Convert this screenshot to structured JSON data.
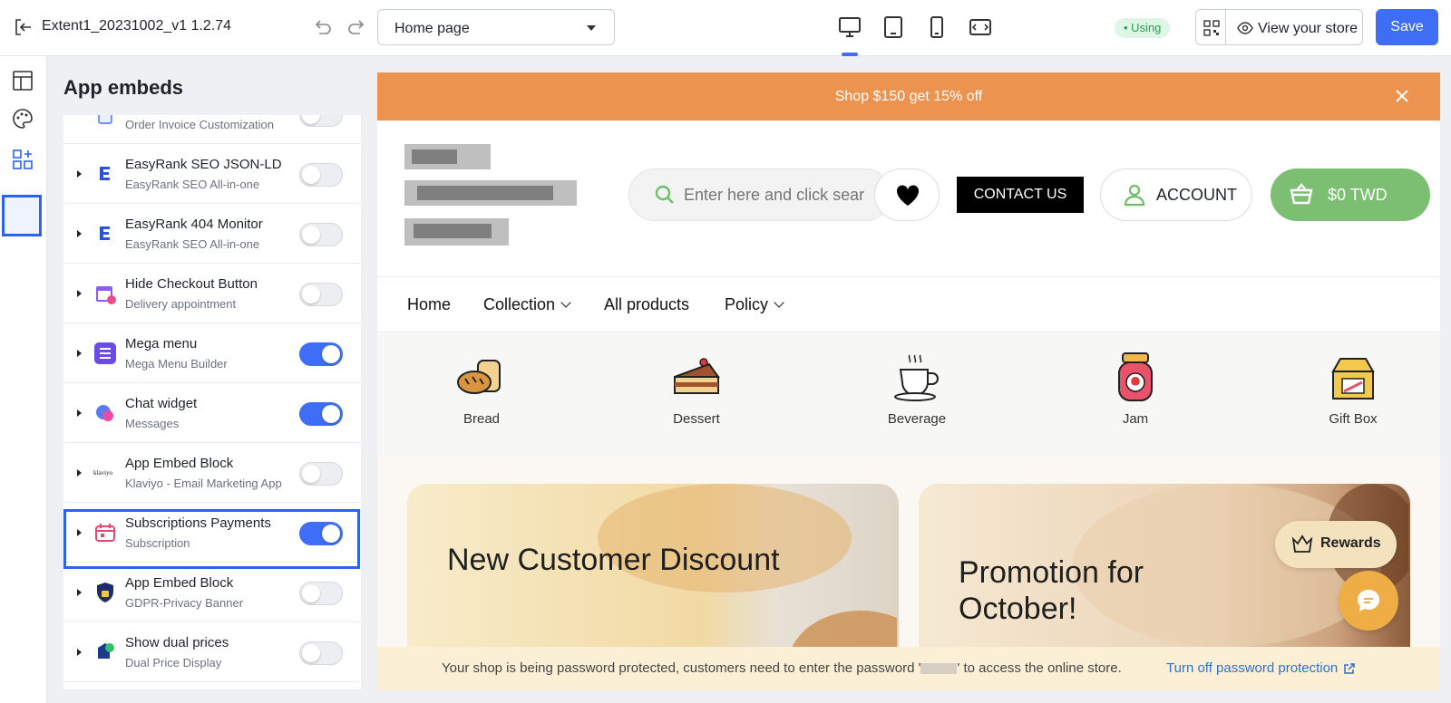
{
  "topbar": {
    "title": "Extent1_20231002_v1 1.2.74",
    "page_select": "Home page",
    "status_badge": "• Using",
    "view_store": "View your store",
    "save": "Save"
  },
  "panel": {
    "title": "App embeds",
    "items": [
      {
        "name": "",
        "sub": "Order Invoice Customization",
        "enabled": false
      },
      {
        "name": "EasyRank SEO JSON-LD",
        "sub": "EasyRank SEO All-in-one",
        "enabled": false
      },
      {
        "name": "EasyRank 404 Monitor",
        "sub": "EasyRank SEO All-in-one",
        "enabled": false
      },
      {
        "name": "Hide Checkout Button",
        "sub": "Delivery appointment",
        "enabled": false
      },
      {
        "name": "Mega menu",
        "sub": "Mega Menu Builder",
        "enabled": true
      },
      {
        "name": "Chat widget",
        "sub": "Messages",
        "enabled": true
      },
      {
        "name": "App Embed Block",
        "sub": "Klaviyo - Email Marketing App",
        "enabled": false,
        "icon_text": "klaviyo"
      },
      {
        "name": "Subscriptions Payments",
        "sub": "Subscription",
        "enabled": true
      },
      {
        "name": "App Embed Block",
        "sub": "GDPR-Privacy Banner",
        "enabled": false
      },
      {
        "name": "Show dual prices",
        "sub": "Dual Price Display",
        "enabled": false
      }
    ]
  },
  "preview": {
    "promo": "Shop $150 get 15% off",
    "search_placeholder": "Enter here and click sear",
    "contact": "CONTACT US",
    "account": "ACCOUNT",
    "cart": "$0 TWD",
    "nav": [
      "Home",
      "Collection",
      "All products",
      "Policy"
    ],
    "categories": [
      "Bread",
      "Dessert",
      "Beverage",
      "Jam",
      "Gift Box"
    ],
    "banner1": "New Customer Discount",
    "banner2": "Promotion for October!",
    "rewards": "Rewards",
    "password_msg_before": "Your shop is being password protected, customers need to enter the password '",
    "password_msg_after": "' to access the online store.",
    "password_link": "Turn off password protection"
  },
  "colors": {
    "accent": "#3d6ef5",
    "promo": "#ec9350",
    "cart": "#7cbf73"
  }
}
